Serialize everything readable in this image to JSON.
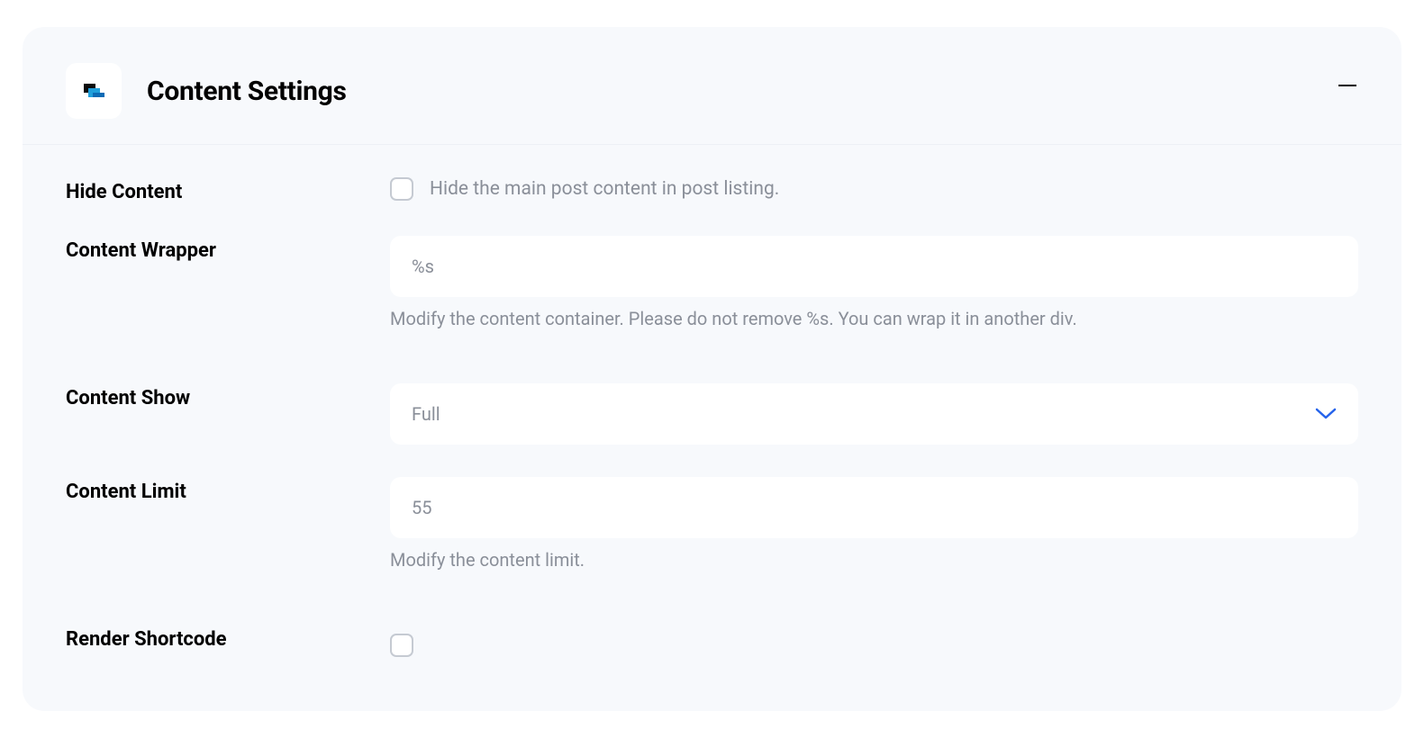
{
  "panel": {
    "title": "Content Settings"
  },
  "fields": {
    "hideContent": {
      "label": "Hide Content",
      "description": "Hide the main post content in post listing."
    },
    "contentWrapper": {
      "label": "Content Wrapper",
      "value": "%s",
      "help": "Modify the content container. Please do not remove %s. You can wrap it in another div."
    },
    "contentShow": {
      "label": "Content Show",
      "value": "Full"
    },
    "contentLimit": {
      "label": "Content Limit",
      "value": "55",
      "help": "Modify the content limit."
    },
    "renderShortcode": {
      "label": "Render Shortcode"
    }
  }
}
